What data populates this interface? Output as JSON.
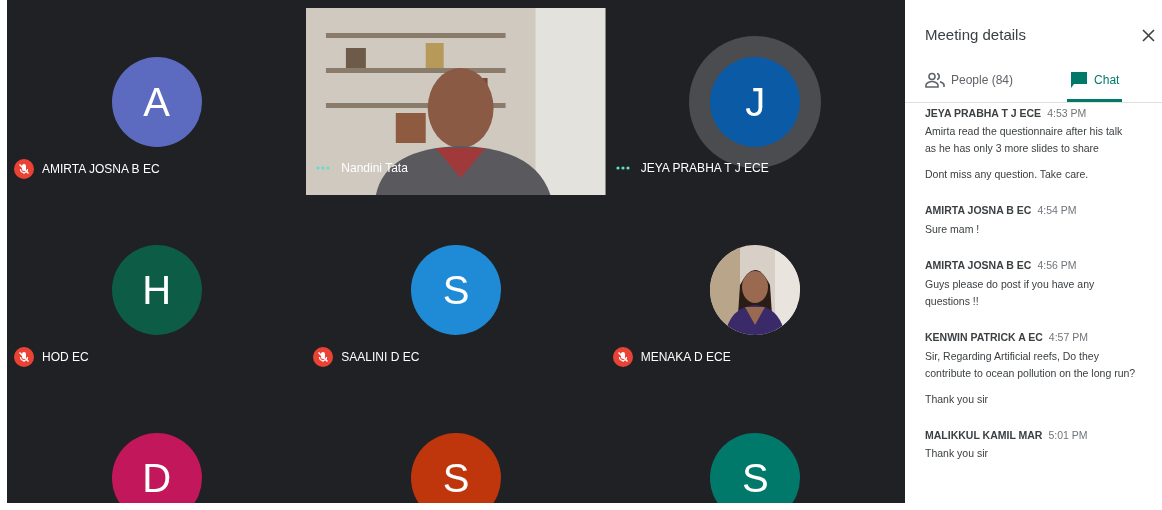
{
  "participants": [
    {
      "name": "AMIRTA JOSNA B EC",
      "kind": "avatar",
      "initial": "A",
      "color": "#5c6bc0",
      "muted": true,
      "speaking": false
    },
    {
      "name": "Nandini Tata",
      "kind": "video",
      "muted": false
    },
    {
      "name": "JEYA PRABHA T J ECE",
      "kind": "avatar",
      "initial": "J",
      "color": "#0b5aa6",
      "muted": false,
      "speaking": true
    },
    {
      "name": "HOD EC",
      "kind": "avatar",
      "initial": "H",
      "color": "#0d5c45",
      "muted": true,
      "speaking": false
    },
    {
      "name": "SAALINI D EC",
      "kind": "avatar",
      "initial": "S",
      "color": "#1f8bd6",
      "muted": true,
      "speaking": false
    },
    {
      "name": "MENAKA D ECE",
      "muted": true
    },
    {
      "kind": "avatar",
      "initial": "D",
      "color": "#c2185b",
      "speaking": false
    },
    {
      "kind": "avatar",
      "initial": "S",
      "color": "#bf360c",
      "speaking": false
    },
    {
      "kind": "avatar",
      "initial": "S",
      "color": "#00796b",
      "speaking": false
    }
  ],
  "panel": {
    "title": "Meeting details",
    "tabs": [
      {
        "label": "People (84)",
        "kind": "people",
        "selected": false
      },
      {
        "label": "Chat",
        "kind": "chat",
        "selected": true
      }
    ],
    "messages": [
      {
        "sender": "JEYA PRABHA T J ECE",
        "time": "4:53 PM",
        "lines": [
          "Amirta read the questionnaire after his talk as he has only 3 more slides to share",
          "Dont miss any question. Take care."
        ]
      },
      {
        "sender": "AMIRTA JOSNA B EC",
        "time": "4:54 PM",
        "lines": [
          "Sure mam !"
        ]
      },
      {
        "sender": "AMIRTA JOSNA B EC",
        "time": "4:56 PM",
        "lines": [
          "Guys please do post if you have any questions !!"
        ]
      },
      {
        "sender": "KENWIN PATRICK A EC",
        "time": "4:57 PM",
        "lines": [
          "Sir, Regarding Artificial reefs, Do they contribute to ocean pollution on the long run?",
          "Thank you sir"
        ]
      },
      {
        "sender": "MALIKKUL KAMIL MAR",
        "time": "5:01 PM",
        "lines": [
          "Thank you sir"
        ]
      }
    ]
  }
}
